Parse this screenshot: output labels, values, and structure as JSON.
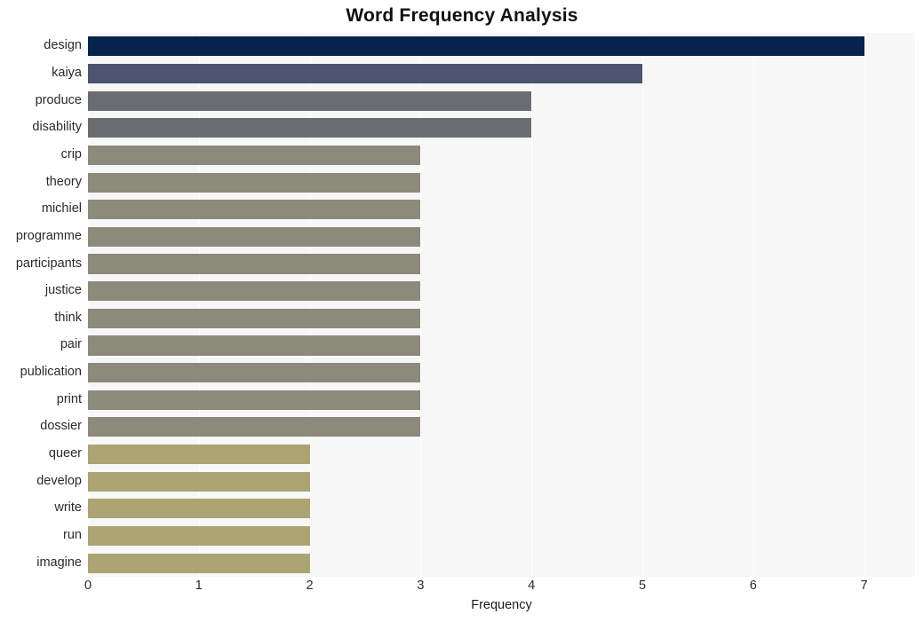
{
  "chart_data": {
    "type": "bar",
    "orientation": "horizontal",
    "title": "Word Frequency Analysis",
    "xlabel": "Frequency",
    "ylabel": "",
    "xlim": [
      0,
      7.46
    ],
    "xticks": [
      0,
      1,
      2,
      3,
      4,
      5,
      6,
      7
    ],
    "xticklabels": [
      "0",
      "1",
      "2",
      "3",
      "4",
      "5",
      "6",
      "7"
    ],
    "grid": "vertical-only",
    "legend": "none",
    "categories": [
      "design",
      "kaiya",
      "produce",
      "disability",
      "crip",
      "theory",
      "michiel",
      "programme",
      "participants",
      "justice",
      "think",
      "pair",
      "publication",
      "print",
      "dossier",
      "queer",
      "develop",
      "write",
      "run",
      "imagine"
    ],
    "values": [
      7,
      5,
      4,
      4,
      3,
      3,
      3,
      3,
      3,
      3,
      3,
      3,
      3,
      3,
      3,
      2,
      2,
      2,
      2,
      2
    ],
    "bar_colors": [
      "#06234d",
      "#4c5470",
      "#6a6c72",
      "#6a6c72",
      "#8c8a7b",
      "#8c8a7b",
      "#8c8a7b",
      "#8c8a7b",
      "#8c8a7b",
      "#8c8a7b",
      "#8c8a7b",
      "#8c8a7b",
      "#8c8a7b",
      "#8c8a7b",
      "#8c8a7b",
      "#aca472",
      "#aca472",
      "#aca472",
      "#aca472",
      "#aca472"
    ]
  },
  "style": {
    "plot_background": "#f7f7f7",
    "grid_color": "#ffffff",
    "figure_background": "#ffffff",
    "title_color": "#101010",
    "tick_color": "#2b2b2b"
  }
}
